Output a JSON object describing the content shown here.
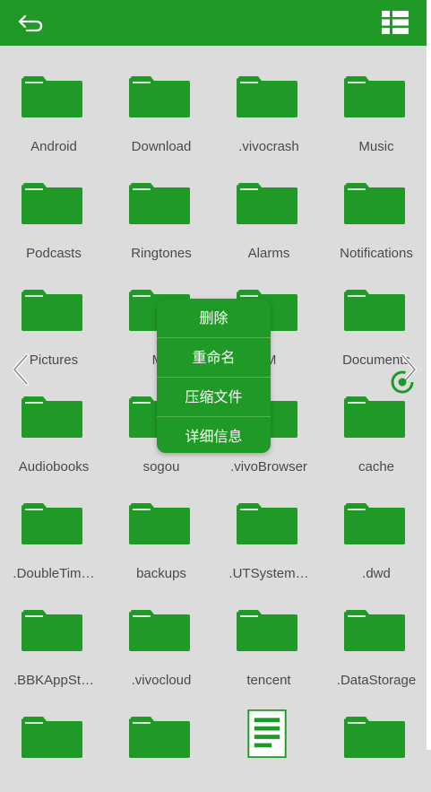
{
  "colors": {
    "accent": "#1f9a26",
    "background": "#dcdcdc",
    "label": "#4a4a4a",
    "menu_text": "#ffffff"
  },
  "toolbar": {
    "back_icon": "back-arrow-icon",
    "view_icon": "list-view-icon"
  },
  "folders": [
    {
      "label": "Android",
      "icon": "folder-icon"
    },
    {
      "label": "Download",
      "icon": "folder-icon"
    },
    {
      "label": ".vivocrash",
      "icon": "folder-icon"
    },
    {
      "label": "Music",
      "icon": "folder-icon"
    },
    {
      "label": "Podcasts",
      "icon": "folder-icon"
    },
    {
      "label": "Ringtones",
      "icon": "folder-icon"
    },
    {
      "label": "Alarms",
      "icon": "folder-icon"
    },
    {
      "label": "Notifications",
      "icon": "folder-icon"
    },
    {
      "label": "Pictures",
      "icon": "folder-icon"
    },
    {
      "label": "Mo",
      "icon": "folder-icon"
    },
    {
      "label": "IM",
      "icon": "folder-icon"
    },
    {
      "label": "Documents",
      "icon": "folder-icon"
    },
    {
      "label": "Audiobooks",
      "icon": "folder-icon"
    },
    {
      "label": "sogou",
      "icon": "folder-icon"
    },
    {
      "label": ".vivoBrowser",
      "icon": "folder-icon"
    },
    {
      "label": "cache",
      "icon": "folder-icon"
    },
    {
      "label": ".DoubleTim…",
      "icon": "folder-icon"
    },
    {
      "label": "backups",
      "icon": "folder-icon"
    },
    {
      "label": ".UTSystem…",
      "icon": "folder-icon"
    },
    {
      "label": ".dwd",
      "icon": "folder-icon"
    },
    {
      "label": ".BBKAppSt…",
      "icon": "folder-icon"
    },
    {
      "label": ".vivocloud",
      "icon": "folder-icon"
    },
    {
      "label": "tencent",
      "icon": "folder-icon"
    },
    {
      "label": ".DataStorage",
      "icon": "folder-icon"
    },
    {
      "label": "",
      "icon": "folder-icon"
    },
    {
      "label": "",
      "icon": "folder-icon"
    },
    {
      "label": "",
      "icon": "document-icon"
    },
    {
      "label": "",
      "icon": "folder-icon"
    }
  ],
  "context_menu": {
    "delete": "删除",
    "rename": "重命名",
    "compress": "压缩文件",
    "details": "详细信息"
  },
  "overlay": {
    "left_arrow": "chevron-left-icon",
    "right_arrow": "chevron-right-icon",
    "refresh": "refresh-icon"
  }
}
